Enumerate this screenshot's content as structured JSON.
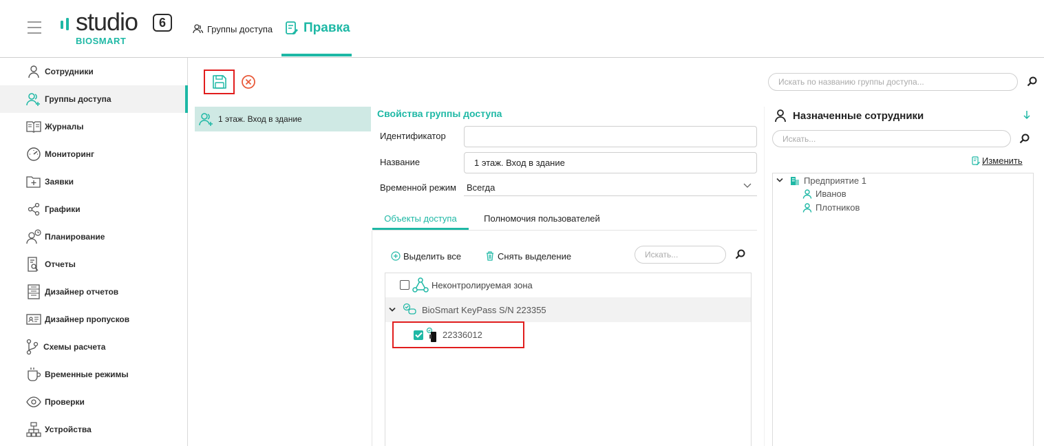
{
  "header": {
    "logo_word": "studio",
    "logo_version": "6",
    "logo_sub": "BIOSMART",
    "crumb_groups": "Группы доступа",
    "crumb_edit": "Правка"
  },
  "sidebar": {
    "items": [
      {
        "label": "Сотрудники",
        "icon": "person-icon"
      },
      {
        "label": "Группы доступа",
        "icon": "group-icon"
      },
      {
        "label": "Журналы",
        "icon": "book-icon"
      },
      {
        "label": "Мониторинг",
        "icon": "gauge-icon"
      },
      {
        "label": "Заявки",
        "icon": "folder-plus-icon"
      },
      {
        "label": "Графики",
        "icon": "share-icon"
      },
      {
        "label": "Планирование",
        "icon": "person-clock-icon"
      },
      {
        "label": "Отчеты",
        "icon": "report-search-icon"
      },
      {
        "label": "Дизайнер отчетов",
        "icon": "report-designer-icon"
      },
      {
        "label": "Дизайнер пропусков",
        "icon": "id-card-icon"
      },
      {
        "label": "Схемы расчета",
        "icon": "branch-icon"
      },
      {
        "label": "Временные режимы",
        "icon": "cup-icon"
      },
      {
        "label": "Проверки",
        "icon": "eye-icon"
      },
      {
        "label": "Устройства",
        "icon": "network-icon"
      }
    ],
    "active_index": 1
  },
  "toolbar": {
    "search_placeholder": "Искать по названию группы доступа..."
  },
  "group_list": {
    "items": [
      "1 этаж. Вход в здание"
    ]
  },
  "properties": {
    "title": "Свойства группы доступа",
    "id_label": "Идентификатор",
    "id_value": "",
    "name_label": "Название",
    "name_value": "1 этаж. Вход в здание",
    "mode_label": "Временной режим",
    "mode_value": "Всегда"
  },
  "tabs": {
    "objects": "Объекты доступа",
    "permissions": "Полномочия пользователей"
  },
  "objects": {
    "select_all": "Выделить все",
    "deselect": "Снять выделение",
    "search_placeholder": "Искать...",
    "tree": {
      "uncontrolled_zone": "Неконтролируемая зона",
      "device": "BioSmart KeyPass S/N 223355",
      "reader": "22336012",
      "reader_checked": true
    }
  },
  "employees": {
    "title": "Назначенные сотрудники",
    "search_placeholder": "Искать...",
    "change_link": "Изменить",
    "org": "Предприятие 1",
    "people": [
      "Иванов",
      "Плотников"
    ]
  },
  "colors": {
    "accent": "#1eb8a5",
    "highlight_border": "#e11d1d",
    "selected_row": "#cfe9e4"
  }
}
